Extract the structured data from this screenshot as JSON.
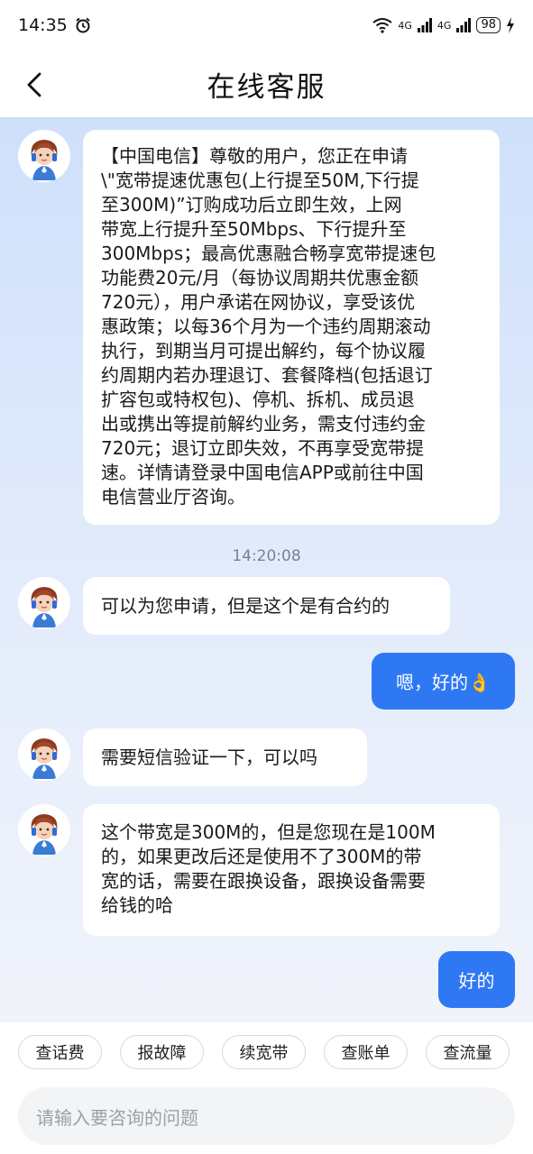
{
  "status_bar": {
    "time": "14:35",
    "battery": "98",
    "net1": "4G",
    "net2": "4G"
  },
  "header": {
    "title": "在线客服"
  },
  "messages": [
    {
      "role": "agent",
      "text": "【中国电信】尊敬的用户，您正在申请\n\\\"宽带提速优惠包(上行提至50M,下行提\n至300M)”订购成功后立即生效，上网\n带宽上行提升至50Mbps、下行提升至\n300Mbps；最高优惠融合畅享宽带提速包\n功能费20元/月（每协议周期共优惠金额\n720元），用户承诺在网协议，享受该优\n惠政策；以每36个月为一个违约周期滚动\n执行，到期当月可提出解约，每个协议履\n约周期内若办理退订、套餐降档(包括退订\n扩容包或特权包)、停机、拆机、成员退\n出或携出等提前解约业务，需支付违约金\n720元；退订立即失效，不再享受宽带提\n速。详情请登录中国电信APP或前往中国\n电信营业厅咨询。"
    },
    {
      "role": "time",
      "text": "14:20:08"
    },
    {
      "role": "agent",
      "text": "可以为您申请，但是这个是有合约的"
    },
    {
      "role": "user",
      "text": "嗯，好的👌"
    },
    {
      "role": "agent",
      "text": "需要短信验证一下，可以吗"
    },
    {
      "role": "agent",
      "text": "这个带宽是300M的，但是您现在是100M\n的，如果更改后还是使用不了300M的带\n宽的话，需要在跟换设备，跟换设备需要\n给钱的哈"
    },
    {
      "role": "user",
      "text": "好的"
    }
  ],
  "quick_replies": [
    "查话费",
    "报故障",
    "续宽带",
    "查账单",
    "查流量"
  ],
  "input": {
    "placeholder": "请输入要咨询的问题"
  },
  "colors": {
    "accent": "#2f78f3",
    "chat_bg": "#dde8fb"
  },
  "icons": [
    "back-arrow-icon",
    "alarm-icon",
    "wifi-icon",
    "signal-icon",
    "charging-icon",
    "agent-avatar"
  ]
}
